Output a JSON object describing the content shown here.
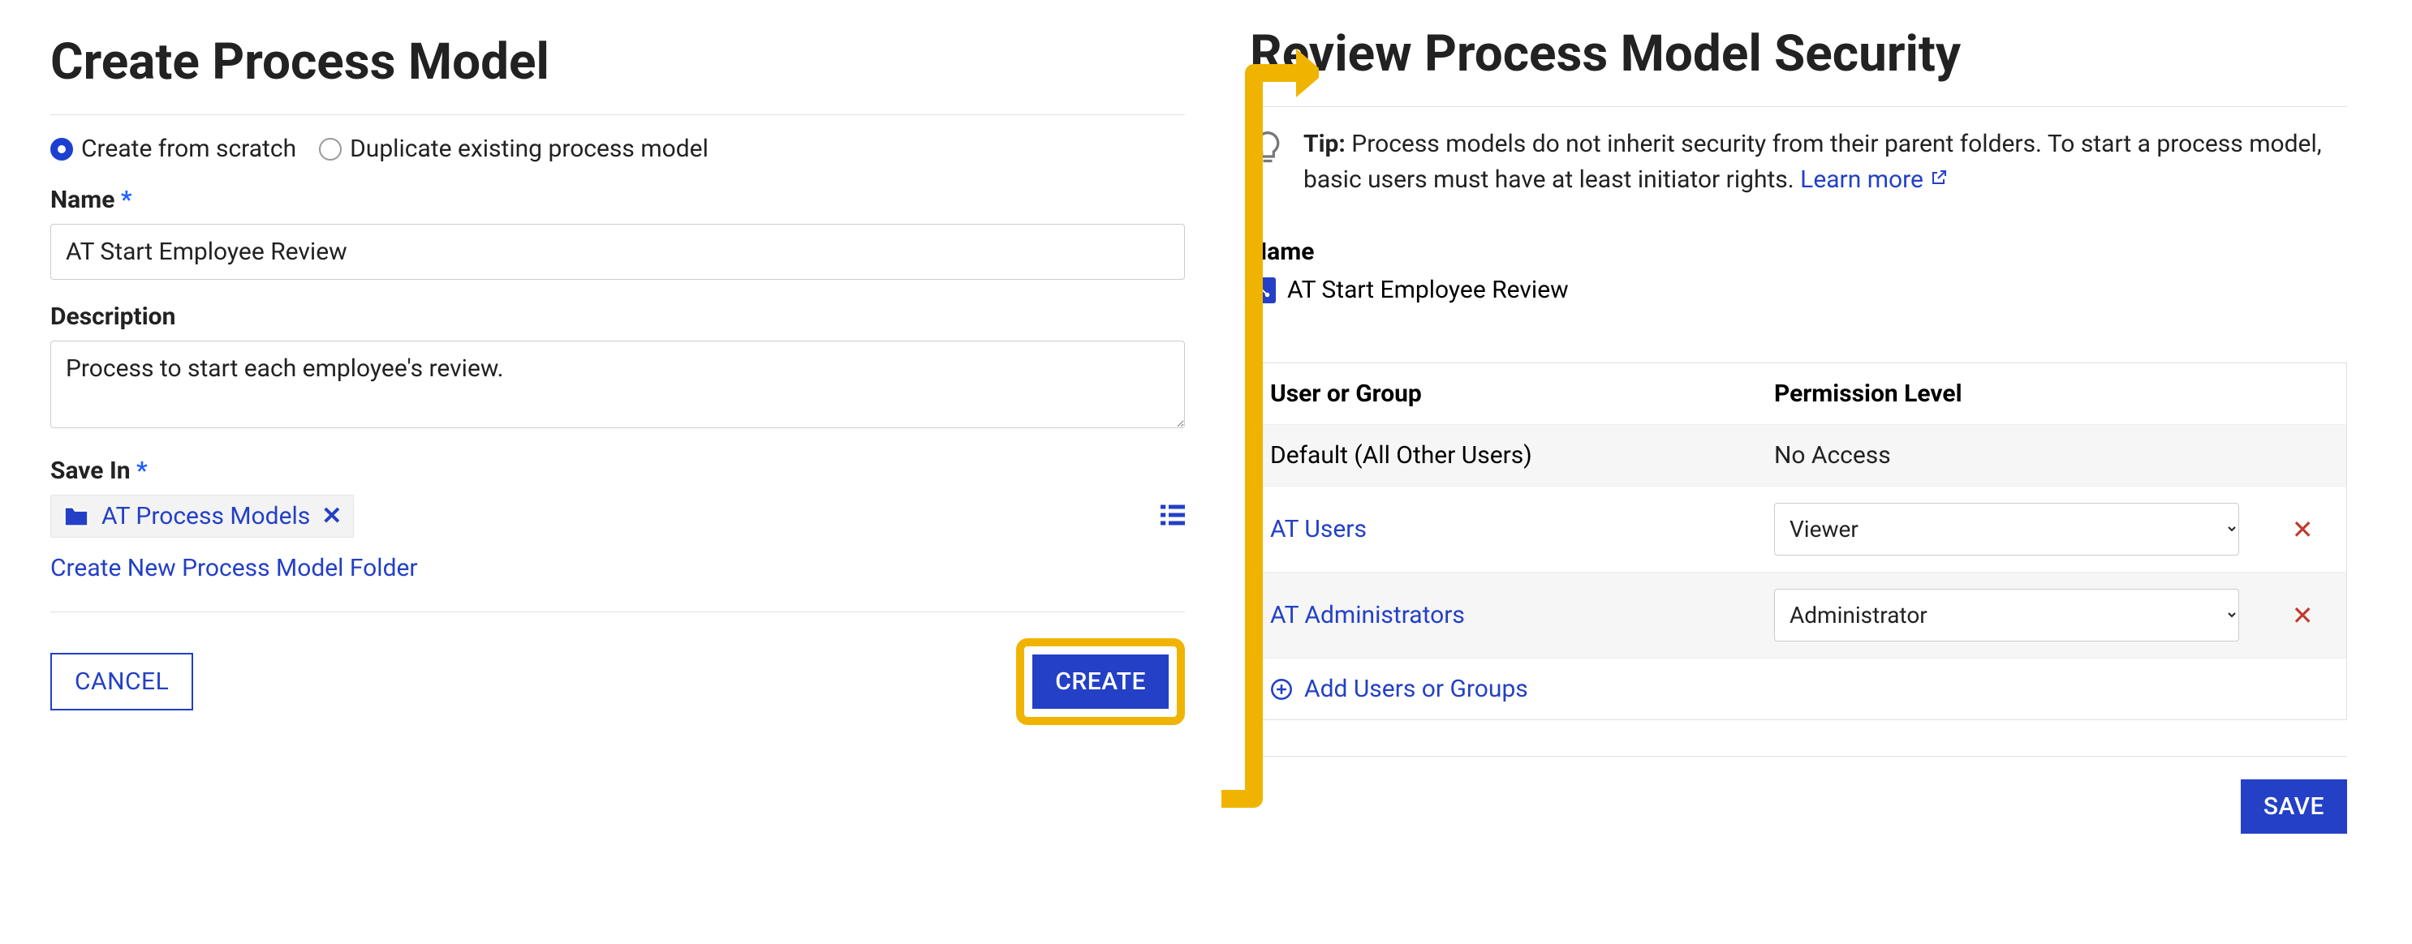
{
  "left": {
    "title": "Create Process Model",
    "radio_scratch_label": "Create from scratch",
    "radio_duplicate_label": "Duplicate existing process model",
    "name_label": "Name",
    "name_value": "AT Start Employee Review",
    "description_label": "Description",
    "description_value": "Process to start each employee's review.",
    "save_in_label": "Save In",
    "folder_chip_name": "AT Process Models",
    "create_folder_link": "Create New Process Model Folder",
    "cancel_label": "CANCEL",
    "create_label": "CREATE"
  },
  "right": {
    "title": "Review Process Model Security",
    "tip_prefix": "Tip:",
    "tip_text": " Process models do not inherit security from their parent folders. To start a process model, basic users must have at least initiator rights. ",
    "learn_more": "Learn more",
    "name_label": "Name",
    "pm_name": "AT Start Employee Review",
    "th_user": "User or Group",
    "th_perm": "Permission Level",
    "rows": [
      {
        "user": "Default (All Other Users)",
        "perm": "No Access",
        "link": false,
        "editable": false,
        "removable": false
      },
      {
        "user": "AT Users",
        "perm": "Viewer",
        "link": true,
        "editable": true,
        "removable": true
      },
      {
        "user": "AT Administrators",
        "perm": "Administrator",
        "link": true,
        "editable": true,
        "removable": true
      }
    ],
    "add_users_label": "Add Users or Groups",
    "save_label": "SAVE"
  }
}
